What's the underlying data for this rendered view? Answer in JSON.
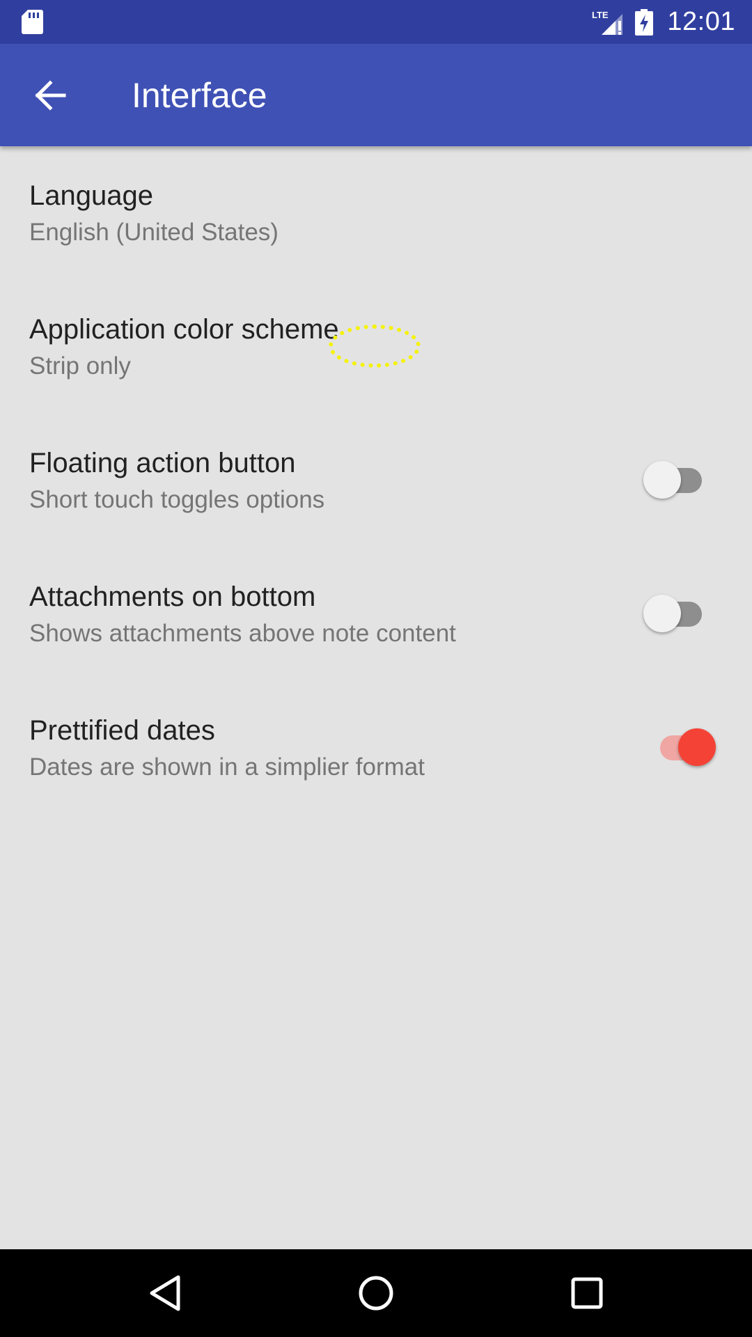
{
  "status_bar": {
    "time": "12:01",
    "network": "LTE",
    "icons": [
      "sd-card-icon",
      "signal-lte-icon",
      "battery-charging-icon"
    ]
  },
  "app_bar": {
    "title": "Interface",
    "back_icon": "arrow-back-icon",
    "color": "#3f51b5",
    "status_color": "#303f9f"
  },
  "preferences": [
    {
      "title": "Language",
      "summary": "English (United States)"
    },
    {
      "title": "Application color scheme",
      "summary": "Strip only"
    },
    {
      "title": "Floating action button",
      "summary": "Short touch toggles options",
      "switch": false
    },
    {
      "title": "Attachments on bottom",
      "summary": "Shows attachments above note content",
      "switch": false
    },
    {
      "title": "Prettified dates",
      "summary": "Dates are shown in a simplier format",
      "switch": true
    }
  ],
  "accent_color": "#f44336",
  "nav_bar": {
    "icons": [
      "back-triangle-icon",
      "home-circle-icon",
      "recents-square-icon"
    ]
  }
}
